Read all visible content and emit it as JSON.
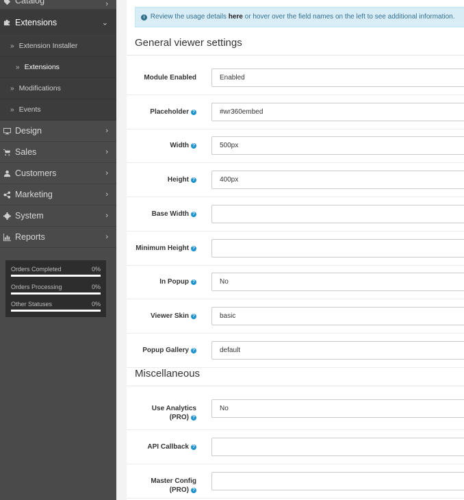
{
  "sidebar": {
    "items": [
      {
        "label": "Catalog",
        "icon": "tag-icon"
      },
      {
        "label": "Extensions",
        "icon": "puzzle-icon"
      },
      {
        "label": "Design",
        "icon": "monitor-icon"
      },
      {
        "label": "Sales",
        "icon": "cart-icon"
      },
      {
        "label": "Customers",
        "icon": "user-icon"
      },
      {
        "label": "Marketing",
        "icon": "share-icon"
      },
      {
        "label": "System",
        "icon": "gear-icon"
      },
      {
        "label": "Reports",
        "icon": "bar-chart-icon"
      }
    ],
    "extensions_sub": [
      "Extension Installer",
      "Extensions",
      "Modifications",
      "Events"
    ]
  },
  "stats": [
    {
      "label": "Orders Completed",
      "value": "0%"
    },
    {
      "label": "Orders Processing",
      "value": "0%"
    },
    {
      "label": "Other Statuses",
      "value": "0%"
    }
  ],
  "info": {
    "before": "Review the usage details ",
    "link": "here",
    "after": " or hover over the field names on the left to see additional information."
  },
  "sections": {
    "general": "General viewer settings",
    "misc": "Miscellaneous"
  },
  "fields": [
    {
      "label": "Module Enabled",
      "value": "Enabled",
      "help": false
    },
    {
      "label": "Placeholder",
      "value": "#wr360embed",
      "help": true
    },
    {
      "label": "Width",
      "value": "500px",
      "help": true
    },
    {
      "label": "Height",
      "value": "400px",
      "help": true
    },
    {
      "label": "Base Width",
      "value": "",
      "help": true
    },
    {
      "label": "Minimum Height",
      "value": "",
      "help": true
    },
    {
      "label": "In Popup",
      "value": "No",
      "help": true
    },
    {
      "label": "Viewer Skin",
      "value": "basic",
      "help": true
    },
    {
      "label": "Popup Gallery",
      "value": "default",
      "help": true
    }
  ],
  "misc_fields": [
    {
      "label1": "Use Analytics",
      "label2": "(PRO)",
      "value": "No"
    },
    {
      "label1": "API Callback",
      "label2": "",
      "value": ""
    },
    {
      "label1": "Master Config",
      "label2": "(PRO)",
      "value": ""
    }
  ]
}
